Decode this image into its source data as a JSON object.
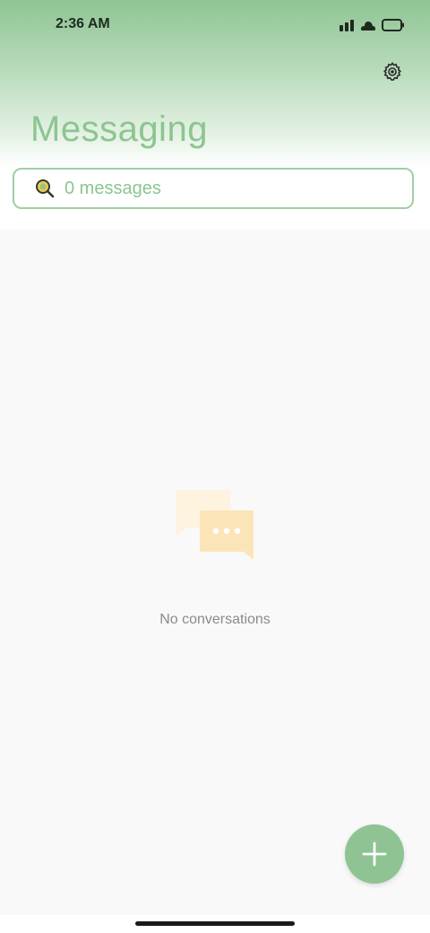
{
  "status_bar": {
    "time": "2:36 AM",
    "icons": [
      "signal-icon",
      "cloud-icon",
      "battery-icon"
    ]
  },
  "header": {
    "title": "Messaging",
    "settings_icon": "gear-icon"
  },
  "search": {
    "text": "0 messages",
    "icon": "search-icon"
  },
  "empty_state": {
    "illustration": "chat-bubbles-icon",
    "text": "No conversations"
  },
  "fab": {
    "icon": "plus-icon"
  },
  "colors": {
    "accent": "#8fc394",
    "title": "#8cc58f",
    "background": "#f9f9f9"
  }
}
